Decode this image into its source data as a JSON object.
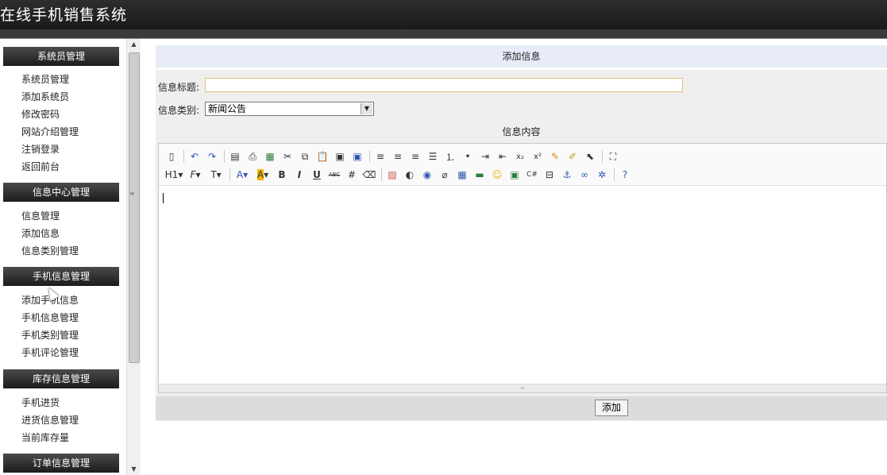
{
  "app": {
    "title": "在线手机销售系统"
  },
  "sidebar": {
    "sections": [
      {
        "title": "系统员管理",
        "items": [
          "系统员管理",
          "添加系统员",
          "修改密码",
          "网站介绍管理",
          "注销登录",
          "返回前台"
        ]
      },
      {
        "title": "信息中心管理",
        "items": [
          "信息管理",
          "添加信息",
          "信息类别管理"
        ]
      },
      {
        "title": "手机信息管理",
        "items": [
          "添加手机信息",
          "手机信息管理",
          "手机类别管理",
          "手机评论管理"
        ]
      },
      {
        "title": "库存信息管理",
        "items": [
          "手机进货",
          "进货信息管理",
          "当前库存量"
        ]
      },
      {
        "title": "订单信息管理",
        "items": []
      }
    ]
  },
  "form": {
    "panel_title": "添加信息",
    "title_label": "信息标题:",
    "title_value": "",
    "category_label": "信息类别:",
    "category_value": "新闻公告",
    "content_label": "信息内容",
    "submit_label": "添加"
  },
  "toolbar": {
    "row1": [
      "source-icon",
      "undo-icon",
      "redo-icon",
      "preview-icon",
      "print-icon",
      "template-icon",
      "cut-icon",
      "copy-icon",
      "paste-icon",
      "paste-text-icon",
      "paste-word-icon",
      "align-left-icon",
      "align-center-icon",
      "align-right-icon",
      "align-justify-icon",
      "ordered-list-icon",
      "unordered-list-icon",
      "indent-icon",
      "outdent-icon",
      "subscript-icon",
      "superscript-icon",
      "clear-format-icon",
      "select-all-icon",
      "select-icon",
      "fullscreen-icon"
    ],
    "row2_text": {
      "heading": "H1",
      "font": "F",
      "size": "T",
      "forecolor": "A",
      "hilite": "A",
      "bold": "B",
      "italic": "I",
      "underline": "U",
      "strike": "ABC"
    }
  }
}
